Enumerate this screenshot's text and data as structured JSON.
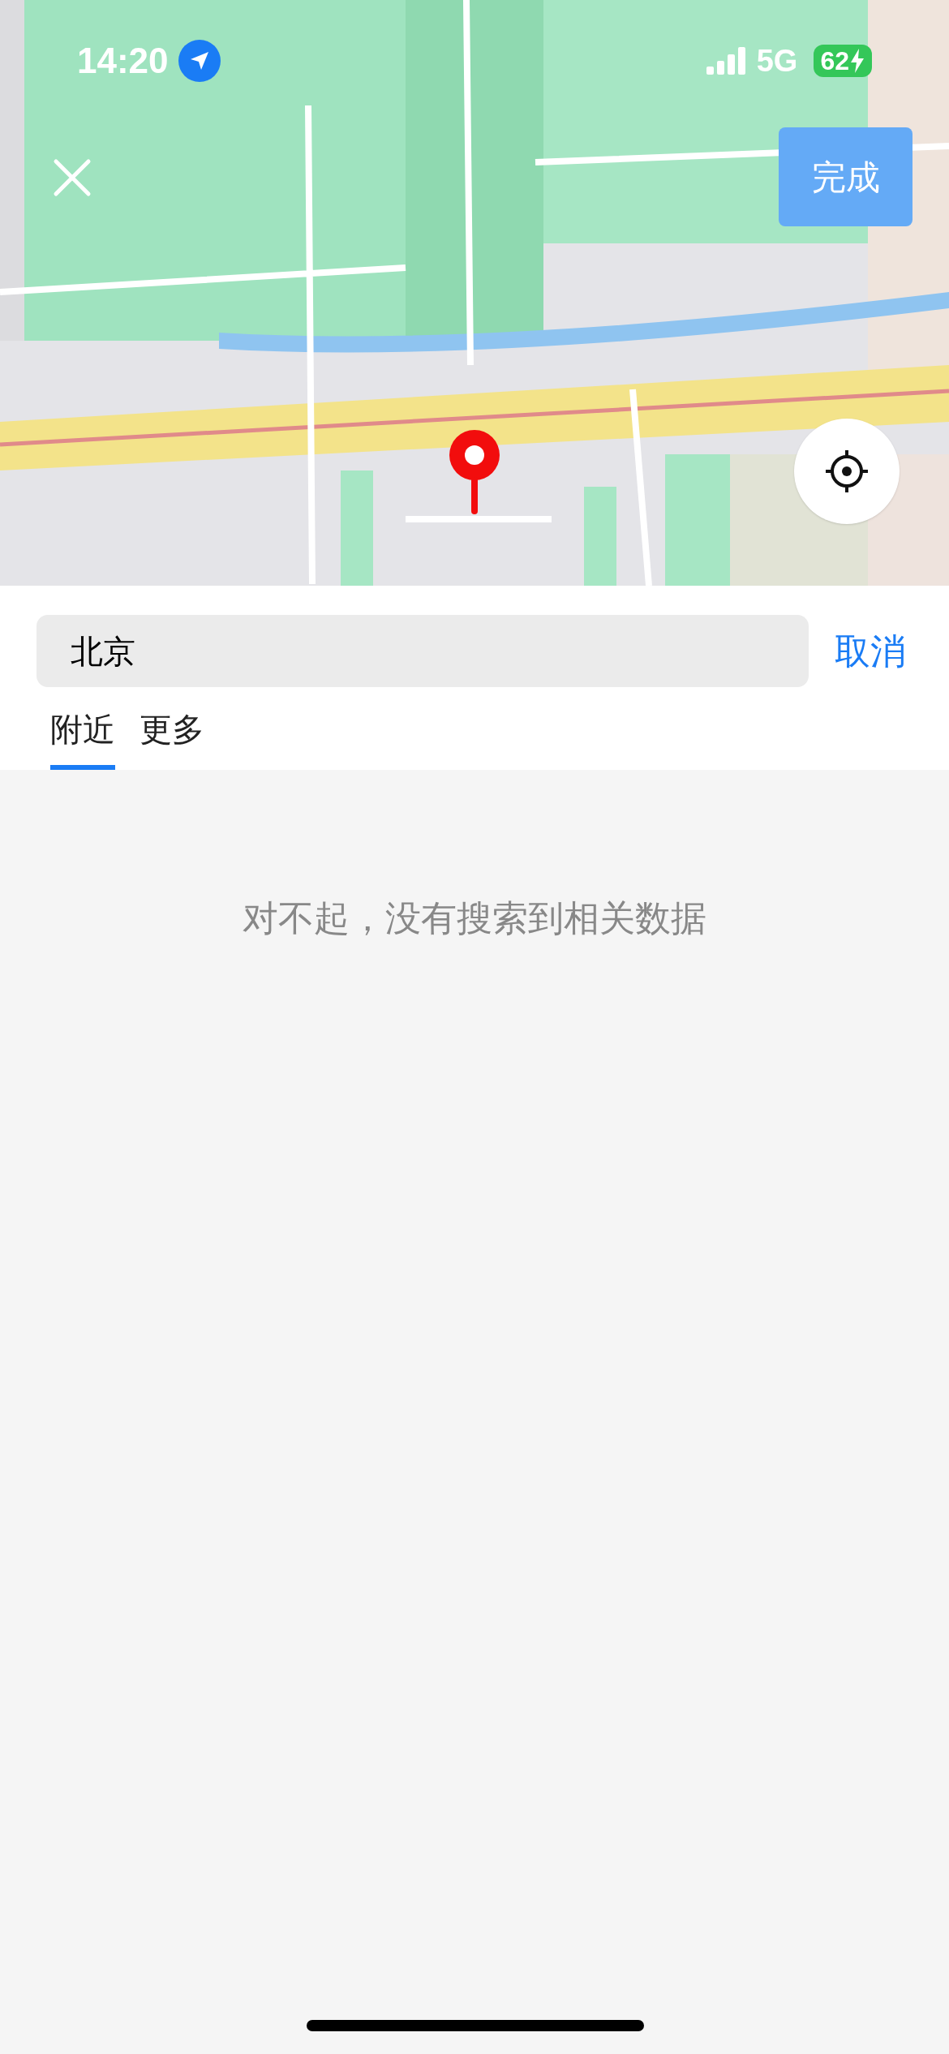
{
  "status_bar": {
    "time": "14:20",
    "network": "5G",
    "battery": "62"
  },
  "map": {
    "done_button": "完成"
  },
  "search": {
    "value": "北京",
    "cancel": "取消"
  },
  "tabs": [
    {
      "label": "附近",
      "selected": true
    },
    {
      "label": "更多",
      "selected": false
    }
  ],
  "empty_message": "对不起，没有搜索到相关数据"
}
